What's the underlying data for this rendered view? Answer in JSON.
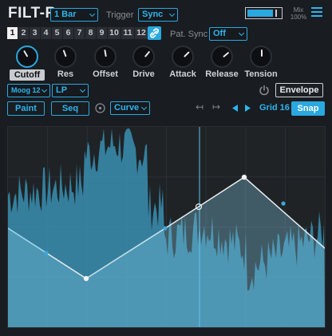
{
  "header": {
    "title": "FILT-R",
    "length_value": "1 Bar",
    "trigger_label": "Trigger",
    "trigger_value": "Sync",
    "mix_label": "Mix",
    "mix_value": "100%",
    "mix_level": 0.75
  },
  "steps": {
    "items": [
      "1",
      "2",
      "3",
      "4",
      "5",
      "6",
      "7",
      "8",
      "9",
      "10",
      "11",
      "12"
    ],
    "active_index": 0
  },
  "pat_sync": {
    "label": "Pat. Sync",
    "value": "Off"
  },
  "knobs": [
    {
      "label": "Cutoff",
      "selected": true
    },
    {
      "label": "Res",
      "selected": false
    },
    {
      "label": "Offset",
      "selected": false
    },
    {
      "label": "Drive",
      "selected": false
    },
    {
      "label": "Attack",
      "selected": false
    },
    {
      "label": "Release",
      "selected": false
    },
    {
      "label": "Tension",
      "selected": false
    }
  ],
  "filter": {
    "model_value": "Moog 12",
    "type_value": "LP",
    "envelope_label": "Envelope"
  },
  "toolbar": {
    "paint_label": "Paint",
    "seq_label": "Seq",
    "curve_value": "Curve",
    "grid_label": "Grid 16",
    "snap_label": "Snap",
    "icons": [
      "undo-icon",
      "redo-icon",
      "arrow-left-icon",
      "arrow-right-icon",
      "power-icon",
      "circle-icon",
      "link-icon",
      "menu-icon"
    ]
  },
  "colors": {
    "accent": "#2aa8e0",
    "background": "#191c20",
    "waveform": "#4fb4d8"
  }
}
